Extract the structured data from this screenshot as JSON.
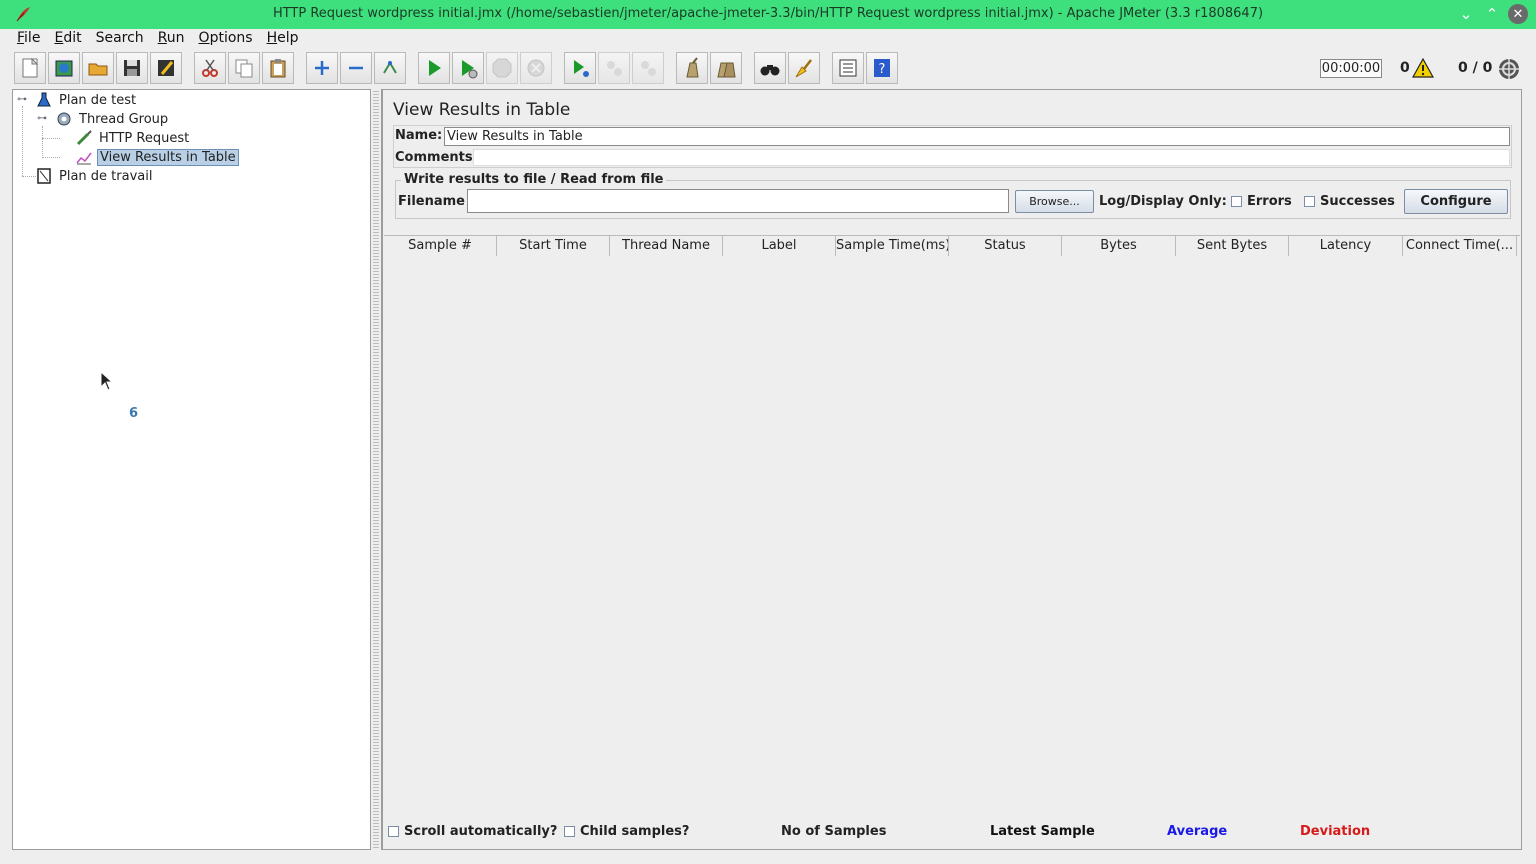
{
  "window": {
    "title": "HTTP Request wordpress initial.jmx (/home/sebastien/jmeter/apache-jmeter-3.3/bin/HTTP Request wordpress initial.jmx) - Apache JMeter (3.3 r1808647)",
    "minimize_glyph": "⌄",
    "maximize_glyph": "⌃",
    "close_glyph": "✕"
  },
  "menu": [
    {
      "key": "F",
      "rest": "ile"
    },
    {
      "key": "E",
      "rest": "dit"
    },
    {
      "key": "",
      "rest": "Search"
    },
    {
      "key": "R",
      "rest": "un"
    },
    {
      "key": "O",
      "rest": "ptions"
    },
    {
      "key": "H",
      "rest": "elp"
    }
  ],
  "toolbar": {
    "icons": [
      "new-icon",
      "templates-icon",
      "open-icon",
      "save-icon",
      "save-as-icon",
      "cut-icon",
      "copy-icon",
      "paste-icon",
      "expand-icon",
      "collapse-icon",
      "toggle-icon",
      "start-icon",
      "start-no-pause-icon",
      "stop-icon",
      "shutdown-icon",
      "remote-start-icon",
      "remote-stop-icon",
      "remote-shutdown-icon",
      "clear-icon",
      "clear-all-icon",
      "search-icon",
      "reset-search-icon",
      "function-helper-icon",
      "help-icon"
    ],
    "timer": "00:00:00",
    "error_count": "0",
    "active_threads": "0 / 0"
  },
  "tree": {
    "nodes": [
      {
        "label": "Plan de test",
        "icon": "test-plan-icon"
      },
      {
        "label": "Thread Group",
        "icon": "thread-group-icon"
      },
      {
        "label": "HTTP Request",
        "icon": "sampler-icon"
      },
      {
        "label": "View Results in Table",
        "icon": "listener-icon",
        "selected": true
      },
      {
        "label": "Plan de travail",
        "icon": "workbench-icon"
      }
    ],
    "expanded_glyph": "⊶",
    "busy_glyph": "6"
  },
  "panel": {
    "title": "View Results in Table",
    "name_label": "Name:",
    "name_value": "View Results in Table",
    "comments_label": "Comments:",
    "comments_value": "",
    "fileset_legend": "Write results to file / Read from file",
    "filename_label": "Filename",
    "filename_value": "",
    "browse_label": "Browse...",
    "log_display_label": "Log/Display Only:",
    "errors_label": "Errors",
    "errors_checked": false,
    "successes_label": "Successes",
    "successes_checked": false,
    "configure_label": "Configure"
  },
  "table": {
    "columns": [
      "Sample #",
      "Start Time",
      "Thread Name",
      "Label",
      "Sample Time(ms)",
      "Status",
      "Bytes",
      "Sent Bytes",
      "Latency",
      "Connect Time(..."
    ],
    "rows": []
  },
  "bottom": {
    "scroll_label": "Scroll automatically?",
    "scroll_checked": false,
    "child_label": "Child samples?",
    "child_checked": false,
    "no_samples": "No of Samples",
    "latest_sample": "Latest Sample",
    "average": "Average",
    "deviation": "Deviation",
    "average_color": "#1a1ae6",
    "deviation_color": "#d61a1a"
  }
}
